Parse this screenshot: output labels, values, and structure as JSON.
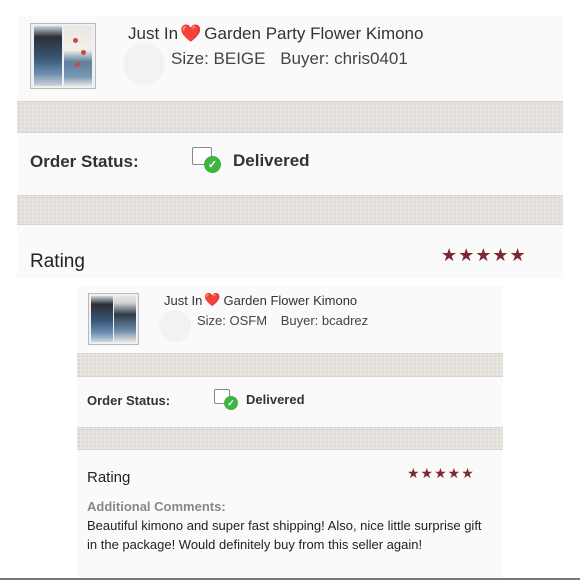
{
  "orders": [
    {
      "title_prefix": "Just In",
      "title_emoji": "❤️",
      "title": "Garden Party Flower Kimono",
      "size_text": "Size: BEIGE",
      "buyer_text": "Buyer: chris0401",
      "status_label": "Order Status:",
      "status_value": "Delivered",
      "rating_label": "Rating",
      "stars": "★★★★★",
      "rating_value": 5
    },
    {
      "title_prefix": "Just In",
      "title_emoji": "❤️",
      "title": "Garden Flower Kimono",
      "size_text": "Size: OSFM",
      "buyer_text": "Buyer: bcadrez",
      "status_label": "Order Status:",
      "status_value": "Delivered",
      "rating_label": "Rating",
      "stars": "★★★★★",
      "rating_value": 5,
      "comments_heading": "Additional Comments:",
      "comments_text": "Beautiful kimono and super fast shipping! Also, nice little surprise gift in the package! Would definitely buy from this seller again!"
    }
  ],
  "colors": {
    "star": "#7b2a30",
    "delivered_check": "#3fb43f",
    "heart": "#e01e2a",
    "band": "#e7e4df"
  },
  "icons": [
    "product-thumbnail",
    "heart-icon",
    "delivered-box-icon",
    "star-icon"
  ]
}
